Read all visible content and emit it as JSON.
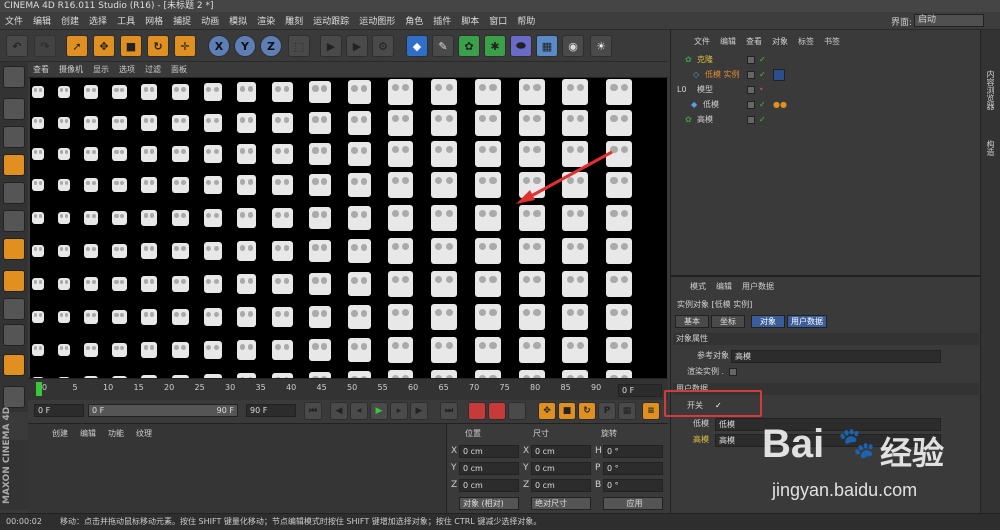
{
  "title": "CINEMA 4D R16.011 Studio (R16) - [未标题 2 *]",
  "menu": [
    "文件",
    "编辑",
    "创建",
    "选择",
    "工具",
    "网格",
    "捕捉",
    "动画",
    "模拟",
    "渲染",
    "雕刻",
    "运动跟踪",
    "运动图形",
    "角色",
    "插件",
    "脚本",
    "窗口",
    "帮助"
  ],
  "layout": {
    "label": "界面:",
    "value": "启动"
  },
  "toolbar_xyz": [
    "X",
    "Y",
    "Z"
  ],
  "viewport_menu": [
    "查看",
    "摄像机",
    "显示",
    "选项",
    "过滤",
    "面板"
  ],
  "timeline": {
    "ticks": [
      "0",
      "5",
      "10",
      "15",
      "20",
      "25",
      "30",
      "35",
      "40",
      "45",
      "50",
      "55",
      "60",
      "65",
      "70",
      "75",
      "80",
      "85",
      "90"
    ],
    "end_frame": "0 F"
  },
  "playback": {
    "start": "0 F",
    "current": "0 F",
    "range_end": "90 F",
    "end": "90 F"
  },
  "material_menu": [
    "创建",
    "编辑",
    "功能",
    "纹理"
  ],
  "coords": {
    "headers": [
      "位置",
      "尺寸",
      "旋转"
    ],
    "rows": [
      {
        "p_axis": "X",
        "p": "0 cm",
        "s_axis": "X",
        "s": "0 cm",
        "r_axis": "H",
        "r": "0 °"
      },
      {
        "p_axis": "Y",
        "p": "0 cm",
        "s_axis": "Y",
        "s": "0 cm",
        "r_axis": "P",
        "r": "0 °"
      },
      {
        "p_axis": "Z",
        "p": "0 cm",
        "s_axis": "Z",
        "s": "0 cm",
        "r_axis": "B",
        "r": "0 °"
      }
    ],
    "mode": "对象 (相对)",
    "size_mode": "绝对尺寸",
    "apply": "应用"
  },
  "object_manager": {
    "menu": [
      "文件",
      "编辑",
      "查看",
      "对象",
      "标签",
      "书签"
    ],
    "rows": [
      {
        "name": "克隆",
        "color": "#e0c040"
      },
      {
        "name": "低模 实例",
        "color": "#e08a30"
      },
      {
        "name": "模型",
        "color": "#cfcfcf"
      },
      {
        "name": "低模",
        "color": "#cfcfcf"
      },
      {
        "name": "高模",
        "color": "#cfcfcf"
      }
    ]
  },
  "attribute_manager": {
    "menu": [
      "模式",
      "编辑",
      "用户数据"
    ],
    "object_title": "实例对象 [低模 实例]",
    "tabs": [
      "基本",
      "坐标",
      "对象",
      "用户数据"
    ],
    "section_object": "对象属性",
    "ref_label": "参考对象",
    "ref_value": "高模",
    "render_instance": "渲染实例 .",
    "section_user": "用户数据",
    "switch_label": "开关",
    "switch_value": "✓",
    "low_label": "低模",
    "low_value": "低模",
    "high_label": "高模",
    "high_value": "高模"
  },
  "side_tabs": [
    "内容浏览器",
    "构造"
  ],
  "maxon": "MAXON CINEMA 4D",
  "status": {
    "time": "00:00:02",
    "text": "移动：点击并拖动鼠标移动元素。按住 SHIFT 键量化移动；节点编辑模式时按住 SHIFT 键增加选择对象；按住 CTRL 键减少选择对象。"
  },
  "watermark": {
    "brand": "Bai",
    "brand2": "经验",
    "url": "jingyan.baidu.com"
  },
  "accent": "#3a5d99",
  "highlight": "#d63b3b"
}
